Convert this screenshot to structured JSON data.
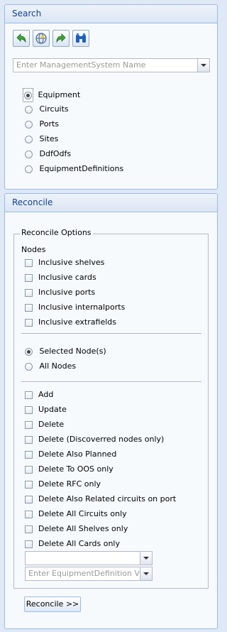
{
  "search": {
    "title": "Search",
    "toolbar": [
      "undo-icon",
      "globe-icon",
      "redo-icon",
      "binoculars-icon"
    ],
    "ms_placeholder": "Enter ManagementSystem Name",
    "types": [
      "Equipment",
      "Circuits",
      "Ports",
      "Sites",
      "DdfOdfs",
      "EquipmentDefinitions"
    ],
    "selected_type": "Equipment"
  },
  "reconcile": {
    "title": "Reconcile",
    "options_legend": "Reconcile Options",
    "nodes_label": "Nodes",
    "inclusive": [
      "Inclusive shelves",
      "Inclusive cards",
      "Inclusive ports",
      "Inclusive internalports",
      "Inclusive extrafields"
    ],
    "scope": [
      "Selected Node(s)",
      "All Nodes"
    ],
    "selected_scope": "Selected Node(s)",
    "actions": [
      "Add",
      "Update",
      "Delete",
      "Delete (Discoverred nodes only)",
      "Delete Also Planned",
      "Delete To OOS only",
      "Delete RFC only",
      "Delete Also Related circuits on port",
      "Delete All Circuits only",
      "Delete All Shelves only",
      "Delete All Cards only"
    ],
    "combo1_value": "",
    "equip_def_placeholder": "Enter EquipmentDefinition V",
    "button_label": "Reconcile >>"
  }
}
